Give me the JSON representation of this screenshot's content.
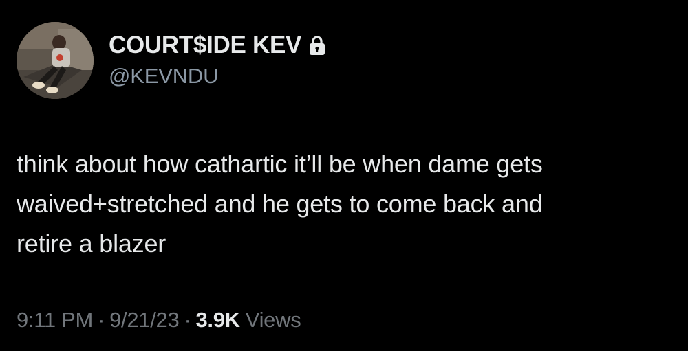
{
  "user": {
    "display_name": "COURT$IDE KEV",
    "handle": "@KEVNDU",
    "protected_icon": "lock-icon"
  },
  "tweet": {
    "text": "think about how cathartic it’ll be when dame gets\nwaived+stretched and he gets to come back and\nretire a blazer"
  },
  "meta": {
    "time": "9:11 PM",
    "separator": "·",
    "date": "9/21/23",
    "views_count": "3.9K",
    "views_label": "Views"
  },
  "colors": {
    "background": "#000000",
    "primary_text": "#e7e9ea",
    "secondary_text": "#71767b"
  }
}
